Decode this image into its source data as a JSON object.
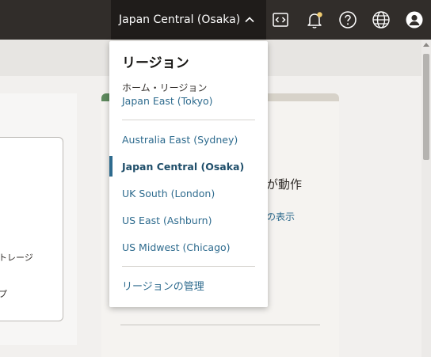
{
  "header": {
    "region_button_label": "Japan Central (Osaka)",
    "icons": [
      "code-editor-icon",
      "bell-icon",
      "help-icon",
      "globe-icon",
      "user-icon"
    ]
  },
  "region_menu": {
    "title": "リージョン",
    "home_label": "ホーム・リージョン",
    "home_value": "Japan East (Tokyo)",
    "regions": [
      {
        "label": "Australia East (Sydney)",
        "selected": false
      },
      {
        "label": "Japan Central (Osaka)",
        "selected": true
      },
      {
        "label": "UK South (London)",
        "selected": false
      },
      {
        "label": "US East (Ashburn)",
        "selected": false
      },
      {
        "label": "US Midwest (Chicago)",
        "selected": false
      }
    ],
    "manage_link": "リージョンの管理"
  },
  "background": {
    "left_card_text_1": "トレージ",
    "left_card_text_2": "プ",
    "right_card_title": "が動作",
    "right_card_link": "の表示"
  },
  "colors": {
    "topbar": "#312d2a",
    "link": "#2e6b8e",
    "notification_dot": "#f0cc71"
  }
}
